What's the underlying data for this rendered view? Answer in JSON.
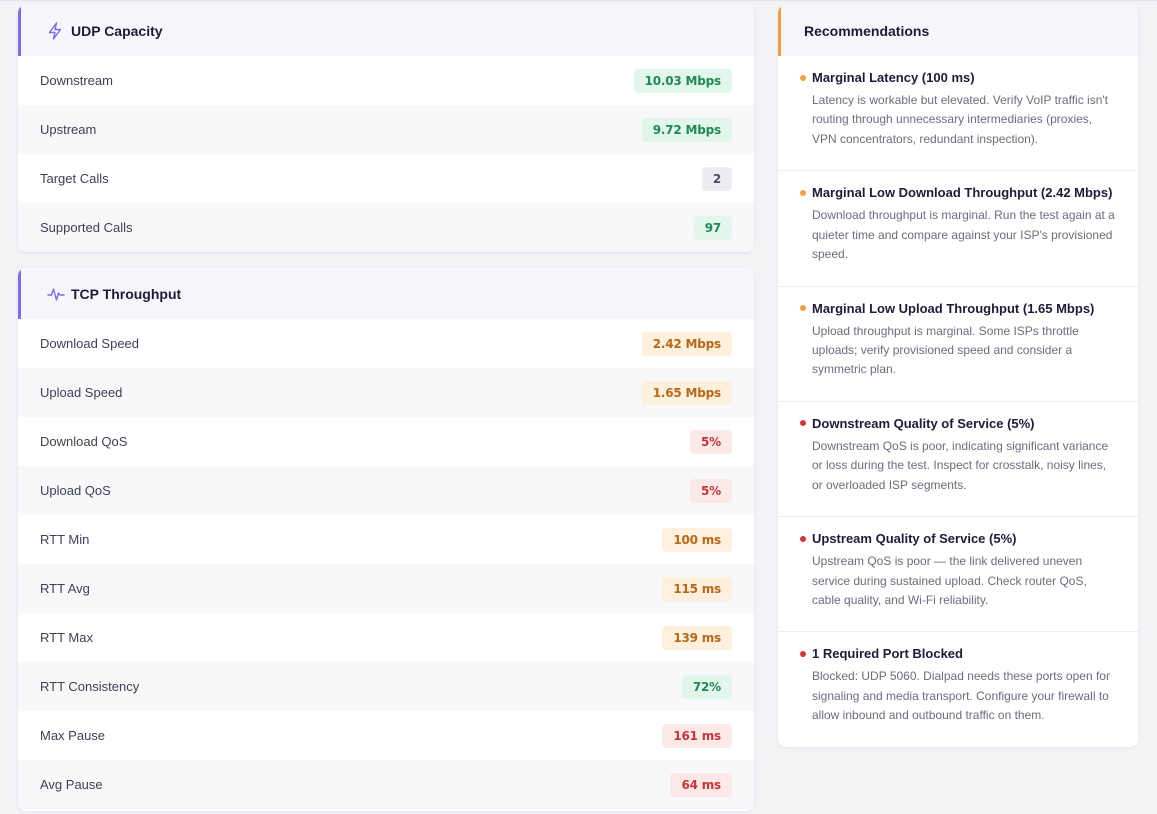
{
  "colors": {
    "accent_purple": "#7b6cf0",
    "accent_orange": "#f0a040",
    "good": "#1f8a55",
    "warn": "#b8681a",
    "bad": "#c8363a"
  },
  "udp": {
    "title": "UDP Capacity",
    "icon": "lightning-icon",
    "rows": [
      {
        "label": "Downstream",
        "value": "10.03 Mbps",
        "status": "good"
      },
      {
        "label": "Upstream",
        "value": "9.72 Mbps",
        "status": "good"
      },
      {
        "label": "Target Calls",
        "value": "2",
        "status": "neutral"
      },
      {
        "label": "Supported Calls",
        "value": "97",
        "status": "good"
      }
    ]
  },
  "tcp": {
    "title": "TCP Throughput",
    "icon": "pulse-icon",
    "rows": [
      {
        "label": "Download Speed",
        "value": "2.42 Mbps",
        "status": "warn"
      },
      {
        "label": "Upload Speed",
        "value": "1.65 Mbps",
        "status": "warn"
      },
      {
        "label": "Download QoS",
        "value": "5%",
        "status": "bad"
      },
      {
        "label": "Upload QoS",
        "value": "5%",
        "status": "bad"
      },
      {
        "label": "RTT Min",
        "value": "100 ms",
        "status": "warn"
      },
      {
        "label": "RTT Avg",
        "value": "115 ms",
        "status": "warn"
      },
      {
        "label": "RTT Max",
        "value": "139 ms",
        "status": "warn"
      },
      {
        "label": "RTT Consistency",
        "value": "72%",
        "status": "good"
      },
      {
        "label": "Max Pause",
        "value": "161 ms",
        "status": "bad"
      },
      {
        "label": "Avg Pause",
        "value": "64 ms",
        "status": "bad"
      }
    ]
  },
  "recommendations": {
    "title": "Recommendations",
    "items": [
      {
        "severity": "warn",
        "title": "Marginal Latency (100 ms)",
        "body": "Latency is workable but elevated. Verify VoIP traffic isn't routing through unnecessary intermediaries (proxies, VPN concentrators, redundant inspection)."
      },
      {
        "severity": "warn",
        "title": "Marginal Low Download Throughput (2.42 Mbps)",
        "body": "Download throughput is marginal. Run the test again at a quieter time and compare against your ISP's provisioned speed."
      },
      {
        "severity": "warn",
        "title": "Marginal Low Upload Throughput (1.65 Mbps)",
        "body": "Upload throughput is marginal. Some ISPs throttle uploads; verify provisioned speed and consider a symmetric plan."
      },
      {
        "severity": "bad",
        "title": "Downstream Quality of Service (5%)",
        "body": "Downstream QoS is poor, indicating significant variance or loss during the test. Inspect for crosstalk, noisy lines, or overloaded ISP segments."
      },
      {
        "severity": "bad",
        "title": "Upstream Quality of Service (5%)",
        "body": "Upstream QoS is poor — the link delivered uneven service during sustained upload. Check router QoS, cable quality, and Wi-Fi reliability."
      },
      {
        "severity": "bad",
        "title": "1 Required Port Blocked",
        "body": "Blocked: UDP 5060. Dialpad needs these ports open for signaling and media transport. Configure your firewall to allow inbound and outbound traffic on them."
      }
    ]
  }
}
